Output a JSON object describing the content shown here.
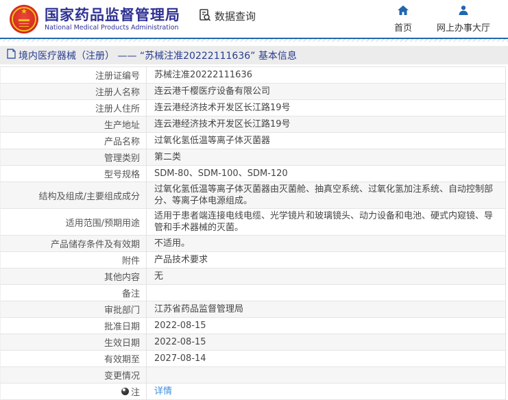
{
  "header": {
    "org_name_cn": "国家药品监督管理局",
    "org_name_en": "National Medical Products Administration",
    "data_query_label": "数据查询",
    "nav_home": "首页",
    "nav_service_hall": "网上办事大厅"
  },
  "title_bar": {
    "text": "境内医疗器械（注册） ——  “苏械注准20222111636” 基本信息"
  },
  "table": {
    "rows": [
      {
        "label": "注册证编号",
        "value": "苏械注准20222111636"
      },
      {
        "label": "注册人名称",
        "value": "连云港千樱医疗设备有限公司"
      },
      {
        "label": "注册人住所",
        "value": "连云港经济技术开发区长江路19号"
      },
      {
        "label": "生产地址",
        "value": "连云港经济技术开发区长江路19号"
      },
      {
        "label": "产品名称",
        "value": "过氧化氢低温等离子体灭菌器"
      },
      {
        "label": "管理类别",
        "value": "第二类"
      },
      {
        "label": "型号规格",
        "value": "SDM-80、SDM-100、SDM-120"
      },
      {
        "label": "结构及组成/主要组成成分",
        "value": "过氧化氢低温等离子体灭菌器由灭菌舱、抽真空系统、过氧化氢加注系统、自动控制部分、等离子体电源组成。"
      },
      {
        "label": "适用范围/预期用途",
        "value": "适用于患者端连接电线电缆、光学镜片和玻璃镜头、动力设备和电池、硬式内窥镜、导管和手术器械的灭菌。"
      },
      {
        "label": "产品储存条件及有效期",
        "value": "不适用。"
      },
      {
        "label": "附件",
        "value": "产品技术要求"
      },
      {
        "label": "其他内容",
        "value": "无"
      },
      {
        "label": "备注",
        "value": ""
      },
      {
        "label": "审批部门",
        "value": "江苏省药品监督管理局"
      },
      {
        "label": "批准日期",
        "value": "2022-08-15"
      },
      {
        "label": "生效日期",
        "value": "2022-08-15"
      },
      {
        "label": "有效期至",
        "value": "2027-08-14"
      },
      {
        "label": "变更情况",
        "value": ""
      },
      {
        "label": "注",
        "value": "详情",
        "link": true,
        "label_icon": "note-bullet"
      }
    ]
  },
  "colors": {
    "brand_blue": "#2e3192",
    "header_line_blue": "#2166ac",
    "nav_icon_blue": "#2066b0",
    "title_text_blue": "#283c8f",
    "link_blue": "#3c8ddc",
    "emblem_red": "#d3281b",
    "emblem_gold": "#f3c11e",
    "titlebar_bg": "#ececec",
    "alt_row_bg": "#f6f6f6"
  }
}
